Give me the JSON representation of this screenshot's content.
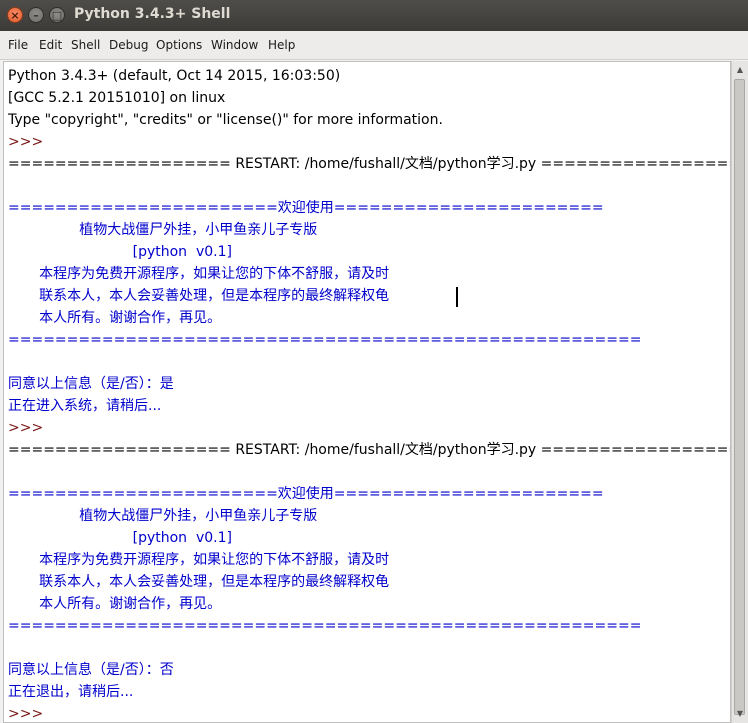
{
  "window": {
    "title": "Python 3.4.3+ Shell"
  },
  "menu": {
    "items": [
      "File",
      "Edit",
      "Shell",
      "Debug",
      "Options",
      "Window",
      "Help"
    ]
  },
  "shell": {
    "lines": [
      "Python 3.4.3+ (default, Oct 14 2015, 16:03:50)",
      "[GCC 5.2.1 20151010] on linux",
      "Type \"copyright\", \"credits\" or \"license()\" for more information.",
      ">>> ",
      "=================== RESTART: /home/fushall/文档/python学习.py ===================",
      "",
      "=======================欢迎使用=======================",
      "                植物大战僵尸外挂，小甲鱼亲儿子专版",
      "                            [python  v0.1]",
      "       本程序为免费开源程序，如果让您的下体不舒服，请及时",
      "       联系本人，本人会妥善处理，但是本程序的最终解释权龟",
      "       本人所有。谢谢合作，再见。",
      "======================================================",
      "",
      "同意以上信息（是/否）：是",
      "正在进入系统，请稍后...",
      ">>> ",
      "=================== RESTART: /home/fushall/文档/python学习.py ===================",
      "",
      "=======================欢迎使用=======================",
      "                植物大战僵尸外挂，小甲鱼亲儿子专版",
      "                            [python  v0.1]",
      "       本程序为免费开源程序，如果让您的下体不舒服，请及时",
      "       联系本人，本人会妥善处理，但是本程序的最终解释权龟",
      "       本人所有。谢谢合作，再见。",
      "======================================================",
      "",
      "同意以上信息（是/否）：否",
      "正在退出，请稍后...",
      ">>> "
    ]
  },
  "colors": {
    "program_output": "#0000cc",
    "user_text": "#000000",
    "prompt": "#7a1616"
  },
  "icons": {
    "close": "close-icon",
    "minimize": "minimize-icon",
    "maximize": "maximize-icon",
    "scroll_up": "arrow-up-icon",
    "scroll_down": "arrow-down-icon"
  }
}
